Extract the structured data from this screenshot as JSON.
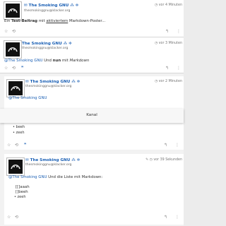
{
  "posts": [
    {
      "name": "The Smoking GNU",
      "handle": "thesmokinggnu@klacker.org",
      "time": "vor 4 Minuten",
      "text_prefix": "Ein ",
      "text_bold": "Test-Beitrag",
      "text_mid": " mit ",
      "text_underlined": "aktiviertem",
      "text_suffix": " Markdown-Poster..."
    },
    {
      "name": "The Smoking GNU",
      "handle": "thesmokinggnu@klacker.org",
      "time": "vor 3 Minuten",
      "mention": "@The Smoking GNU",
      "text_mid": " Und ",
      "text_bold": "nun",
      "text_mid2": " mit ",
      "text_italic": "Markdown"
    },
    {
      "name": "The Smoking GNU",
      "handle": "thesmokinggnu@klacker.org",
      "time": "vor 2 Minuten",
      "mention": "@The Smoking GNU",
      "bullets": [
        "beeh",
        "zeeh"
      ]
    },
    {
      "name": "The Smoking GNU",
      "handle": "thesmokinggnu@klacker.org",
      "time": "vor 39 Sekunden",
      "mention": "@The Smoking GNU",
      "text_after": " Und die Liste mit Markdown:",
      "lines": [
        "[[]aaah",
        "[]beeh"
      ],
      "bullet": "zeeh"
    }
  ],
  "toast": {
    "label": "Kanal"
  },
  "icons": {
    "star": "star-icon",
    "reply": "reply-icon",
    "share": "share-icon",
    "clock": "clock-icon",
    "edit": "edit-icon",
    "mail": "envelope-icon"
  }
}
